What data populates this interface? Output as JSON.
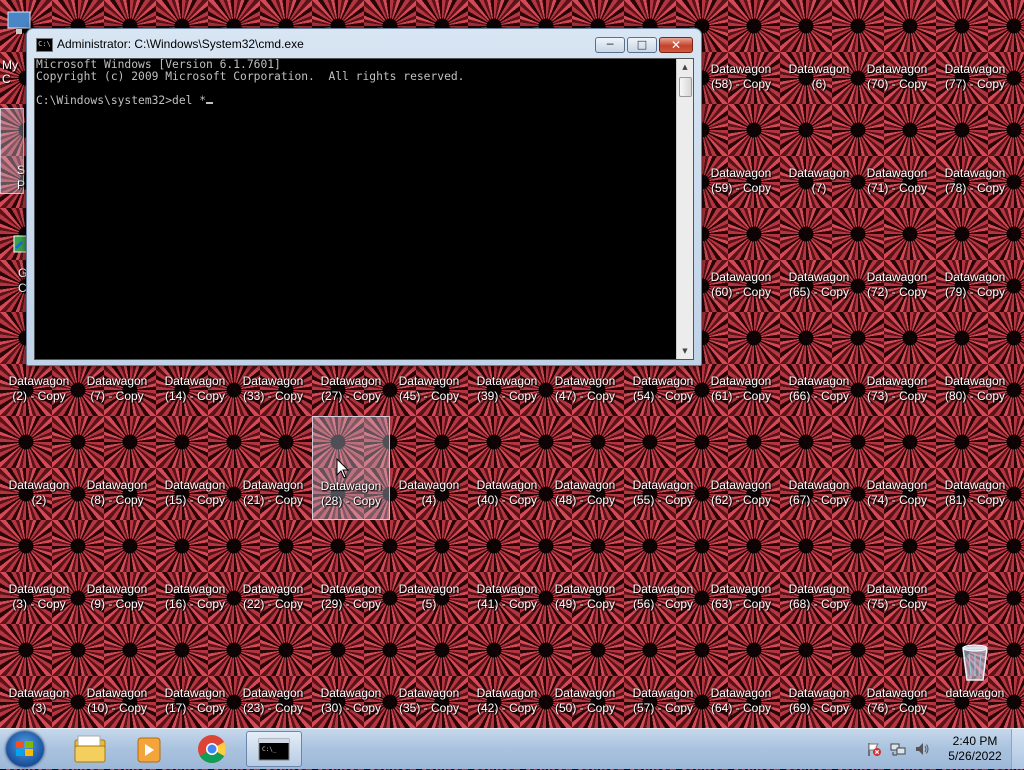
{
  "desktop": {
    "icon_label_main": "Datawagon",
    "grid": [
      [
        "(58) - Copy",
        "(6)",
        "(70) - Copy",
        "(77) - Copy"
      ],
      [
        "(59) - Copy",
        "(7)",
        "(71) - Copy",
        "(78) - Copy"
      ],
      [
        "(60) - Copy",
        "(65) - Copy",
        "(72) - Copy",
        "(79) - Copy"
      ],
      [
        "(2) - Copy",
        "(7) - Copy",
        "(14) - Copy",
        "(33) - Copy",
        "(27) - Copy",
        "(45) - Copy",
        "(39) - Copy",
        "(47) - Copy",
        "(54) - Copy",
        "(61) - Copy",
        "(66) - Copy",
        "(73) - Copy",
        "(80) - Copy"
      ],
      [
        "(2)",
        "(8) - Copy",
        "(15) - Copy",
        "(21) - Copy",
        "(28) - Copy",
        "(4)",
        "(40) - Copy",
        "(48) - Copy",
        "(55) - Copy",
        "(62) - Copy",
        "(67) - Copy",
        "(74) - Copy",
        "(81) - Copy"
      ],
      [
        "(3) - Copy",
        "(9) - Copy",
        "(16) - Copy",
        "(22) - Copy",
        "(29) - Copy",
        "(5)",
        "(41) - Copy",
        "(49) - Copy",
        "(56) - Copy",
        "(63) - Copy",
        "(68) - Copy",
        "(75) - Copy"
      ],
      [
        "(3)",
        "(10) - Copy",
        "(17) - Copy",
        "(23) - Copy",
        "(30) - Copy",
        "(35) - Copy",
        "(42) - Copy",
        "(50) - Copy",
        "(57) - Copy",
        "(64) - Copy",
        "(69) - Copy",
        "(76) - Copy"
      ]
    ],
    "selected_suffix": "(28) - Copy",
    "recycle_bin_label": "datawagon",
    "partial_left": [
      "My C",
      "S",
      "P",
      "G",
      "C"
    ]
  },
  "cmd": {
    "title": "Administrator: C:\\Windows\\System32\\cmd.exe",
    "icon_text": "C:\\",
    "console_lines": [
      "Microsoft Windows [Version 6.1.7601]",
      "Copyright (c) 2009 Microsoft Corporation.  All rights reserved.",
      "",
      "C:\\Windows\\system32>del *"
    ],
    "min_glyph": "─",
    "max_glyph": "□",
    "close_glyph": "✕"
  },
  "taskbar": {
    "pinned": [
      "explorer-icon",
      "media-player-icon",
      "chrome-icon",
      "cmd-icon"
    ],
    "time": "2:40 PM",
    "date": "5/26/2022"
  },
  "colors": {
    "wallpaper_red": "#b3353f",
    "console_bg": "#000000",
    "console_text": "#c0c0c0",
    "close_red": "#c2432d"
  }
}
